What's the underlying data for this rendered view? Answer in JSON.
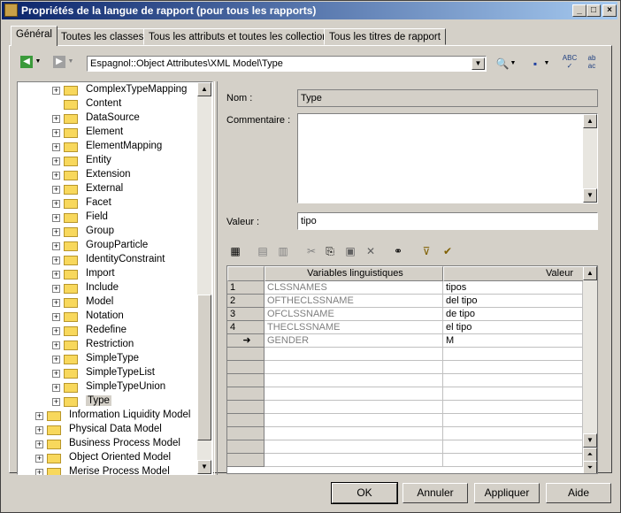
{
  "window": {
    "title": "Propriétés de la langue de rapport (pour tous les rapports)"
  },
  "tabs": [
    {
      "label": "Général"
    },
    {
      "label": "Toutes les classes"
    },
    {
      "label": "Tous les attributs et toutes les collections"
    },
    {
      "label": "Tous les titres de rapport"
    }
  ],
  "path": {
    "value": "Espagnol::Object Attributes\\XML Model\\Type"
  },
  "toolbar_icons": [
    "back-icon",
    "forward-icon",
    "find-icon",
    "save-icon",
    "spellcheck-icon",
    "replace-icon"
  ],
  "tree": {
    "items": [
      {
        "label": "ComplexTypeMapping",
        "expander": "+"
      },
      {
        "label": "Content",
        "expander": ""
      },
      {
        "label": "DataSource",
        "expander": "+"
      },
      {
        "label": "Element",
        "expander": "+"
      },
      {
        "label": "ElementMapping",
        "expander": "+"
      },
      {
        "label": "Entity",
        "expander": "+"
      },
      {
        "label": "Extension",
        "expander": "+"
      },
      {
        "label": "External",
        "expander": "+"
      },
      {
        "label": "Facet",
        "expander": "+"
      },
      {
        "label": "Field",
        "expander": "+"
      },
      {
        "label": "Group",
        "expander": "+"
      },
      {
        "label": "GroupParticle",
        "expander": "+"
      },
      {
        "label": "IdentityConstraint",
        "expander": "+"
      },
      {
        "label": "Import",
        "expander": "+"
      },
      {
        "label": "Include",
        "expander": "+"
      },
      {
        "label": "Model",
        "expander": "+"
      },
      {
        "label": "Notation",
        "expander": "+"
      },
      {
        "label": "Redefine",
        "expander": "+"
      },
      {
        "label": "Restriction",
        "expander": "+"
      },
      {
        "label": "SimpleType",
        "expander": "+"
      },
      {
        "label": "SimpleTypeList",
        "expander": "+"
      },
      {
        "label": "SimpleTypeUnion",
        "expander": "+"
      },
      {
        "label": "Type",
        "expander": "+",
        "selected": true
      },
      {
        "label": "Information Liquidity Model",
        "expander": "+",
        "top": true
      },
      {
        "label": "Physical Data Model",
        "expander": "+",
        "top": true
      },
      {
        "label": "Business Process Model",
        "expander": "+",
        "top": true
      },
      {
        "label": "Object Oriented Model",
        "expander": "+",
        "top": true
      },
      {
        "label": "Merise Process Model",
        "expander": "+",
        "top": true
      }
    ]
  },
  "form": {
    "name_label": "Nom :",
    "name_value": "Type",
    "comment_label": "Commentaire :",
    "comment_value": "",
    "value_label": "Valeur :",
    "value_value": "tipo"
  },
  "grid": {
    "headers": [
      "Variables linguistiques",
      "Valeur"
    ],
    "rows": [
      {
        "num": "1",
        "var": "CLSSNAMES",
        "val": "tipos"
      },
      {
        "num": "2",
        "var": "OFTHECLSSNAME",
        "val": "del tipo"
      },
      {
        "num": "3",
        "var": "OFCLSSNAME",
        "val": "de tipo"
      },
      {
        "num": "4",
        "var": "THECLSSNAME",
        "val": "el tipo"
      },
      {
        "num": "➜",
        "var": "GENDER",
        "val": "M"
      }
    ]
  },
  "buttons": {
    "ok": "OK",
    "cancel": "Annuler",
    "apply": "Appliquer",
    "help": "Aide"
  },
  "colors": {
    "title_start": "#0a246a",
    "title_end": "#a6caf0",
    "face": "#d4d0c8"
  }
}
